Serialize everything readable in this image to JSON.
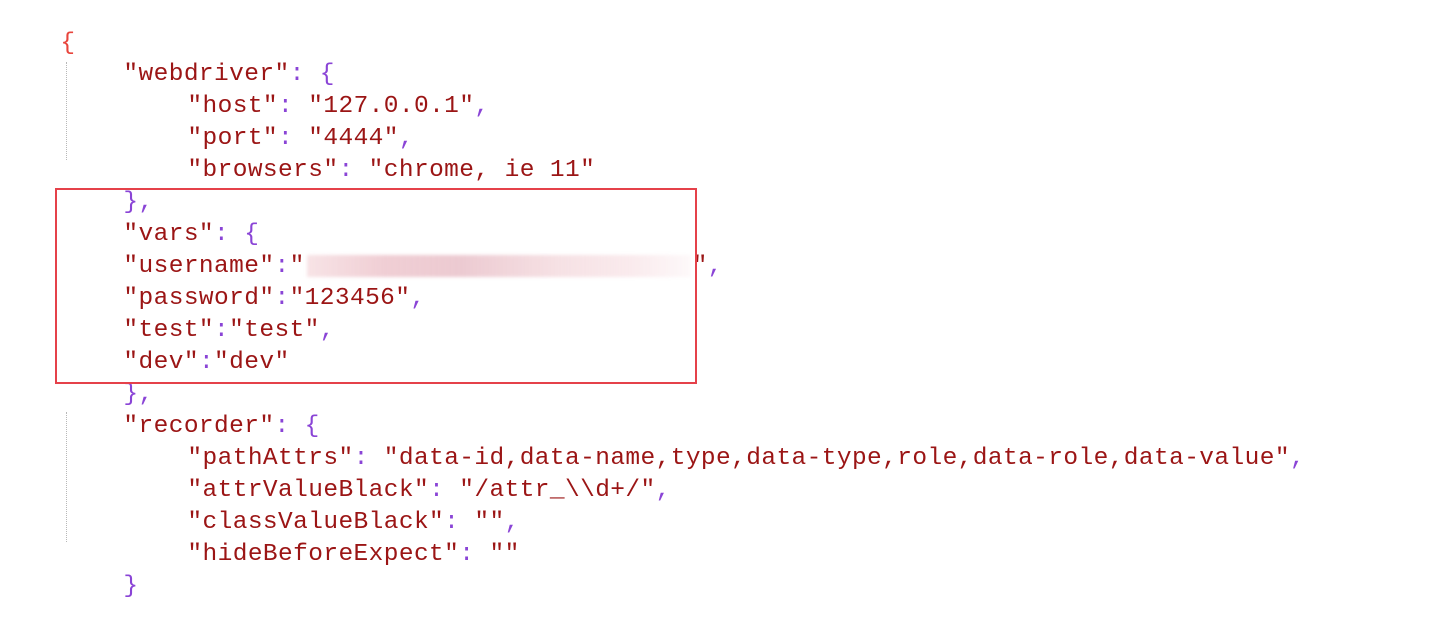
{
  "editor": {
    "open_brace": "{",
    "webdriver": {
      "key": "\"webdriver\"",
      "colon_open": ": {",
      "host_key": "\"host\"",
      "host_value": "\"127.0.0.1\"",
      "port_key": "\"port\"",
      "port_value": "\"4444\"",
      "browsers_key": "\"browsers\"",
      "browsers_value": "\"chrome, ie 11\"",
      "close": "},"
    },
    "vars": {
      "key": "\"vars\"",
      "colon_open": ": {",
      "username_key": "\"username\"",
      "username_open_quote": "\"",
      "username_close_quote": "\"",
      "password_key": "\"password\"",
      "password_value": "\"123456\"",
      "test_key": "\"test\"",
      "test_value": "\"test\"",
      "dev_key": "\"dev\"",
      "dev_value": "\"dev\"",
      "close": "},"
    },
    "recorder": {
      "key": "\"recorder\"",
      "colon_open": ": {",
      "pathAttrs_key": "\"pathAttrs\"",
      "pathAttrs_value": "\"data-id,data-name,type,data-type,role,data-role,data-value\"",
      "attrValueBlack_key": "\"attrValueBlack\"",
      "attrValueBlack_value": "\"/attr_\\\\d+/\"",
      "classValueBlack_key": "\"classValueBlack\"",
      "classValueBlack_value": "\"\"",
      "hideBeforeExpect_key": "\"hideBeforeExpect\"",
      "hideBeforeExpect_value": "\"\"",
      "close": "}"
    }
  },
  "colors": {
    "string": "#9b1515",
    "punctuation": "#8a44d6",
    "root_brace": "#e8453c",
    "highlight_border": "#e5414a"
  }
}
